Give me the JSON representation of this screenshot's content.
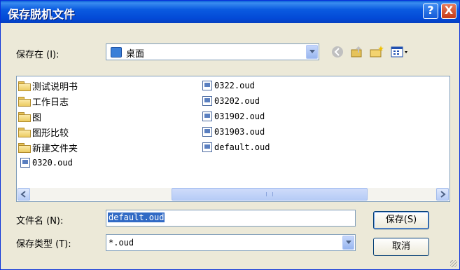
{
  "dialog": {
    "title": "保存脱机文件",
    "help_label": "?",
    "close_label": "X"
  },
  "location": {
    "label": "保存在 (I):",
    "current": "桌面"
  },
  "toolbar": {
    "back_icon": "back-arrow-icon",
    "up_icon": "up-folder-icon",
    "new_folder_icon": "new-folder-icon",
    "view_menu_icon": "view-menu-icon"
  },
  "files": {
    "folders": [
      "测试说明书",
      "工作日志",
      "图",
      "图形比较",
      "新建文件夹"
    ],
    "col1_files": [
      "0320.oud"
    ],
    "col2_files": [
      "0322.oud",
      "03202.oud",
      "031902.oud",
      "031903.oud",
      "default.oud"
    ]
  },
  "filename": {
    "label": "文件名 (N):",
    "value": "default.oud"
  },
  "filetype": {
    "label": "保存类型 (T):",
    "value": "*.oud"
  },
  "buttons": {
    "save": "保存(S)",
    "cancel": "取消"
  }
}
